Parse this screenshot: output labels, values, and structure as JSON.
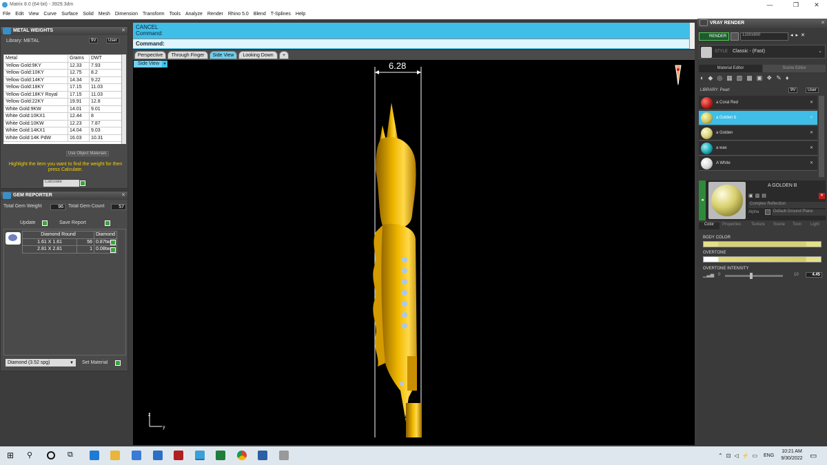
{
  "window": {
    "title": "Matrix 8.0 (64-bit) - 3929.3dm",
    "min": "—",
    "max": "❐",
    "close": "✕"
  },
  "menu": [
    "File",
    "Edit",
    "View",
    "Curve",
    "Surface",
    "Solid",
    "Mesh",
    "Dimension",
    "Transform",
    "Tools",
    "Analyze",
    "Render",
    "Rhino 5.0",
    "Blend",
    "T-Splines",
    "Help"
  ],
  "metal_weights": {
    "title": "METAL WEIGHTS",
    "library_label": "Library: METAL",
    "lib_btns": [
      "9V",
      "User"
    ],
    "columns": [
      "Metal",
      "Grams",
      "DWT"
    ],
    "rows": [
      [
        "Yellow Gold:9KY",
        "12.33",
        "7.93"
      ],
      [
        "Yellow Gold:10KY",
        "12.75",
        "8.2"
      ],
      [
        "Yellow Gold:14KY",
        "14.34",
        "9.22"
      ],
      [
        "Yellow Gold:18KY",
        "17.15",
        "11.03"
      ],
      [
        "Yellow Gold:18KY Royal",
        "17.15",
        "11.03"
      ],
      [
        "Yellow Gold:22KY",
        "19.91",
        "12.8"
      ],
      [
        "White Gold:9KW",
        "14.01",
        "9.01"
      ],
      [
        "White Gold:10KX1",
        "12.44",
        "8"
      ],
      [
        "White Gold:10KW",
        "12.23",
        "7.87"
      ],
      [
        "White Gold:14KX1",
        "14.04",
        "9.03"
      ],
      [
        "White Gold:14K PdW",
        "16.03",
        "10.31"
      ]
    ],
    "use_object": "Use Object Materials",
    "instruction": "Highlight the item you want to find the weight for then press Calculate.",
    "calculate": "Calculate"
  },
  "gem_reporter": {
    "title": "GEM REPORTER",
    "total_weight_label": "Total Gem Weight",
    "total_weight": "96",
    "total_count_label": "Total Gem Count",
    "total_count": "57",
    "update": "Update",
    "save_report": "Save Report",
    "columns": [
      "Diamond Round",
      "Diamond"
    ],
    "rows": [
      [
        "1.61 X 1.61",
        "56",
        "0.87tw"
      ],
      [
        "2.81 X 2.81",
        "1",
        "0.08tw"
      ]
    ],
    "material_select": "Diamond    (3.52 spg)",
    "set_material": "Set Material"
  },
  "command": {
    "line1": "CANCEL",
    "line2": "Command:",
    "prompt": "Command:"
  },
  "view_tabs": [
    "Perspective",
    "Through Finger",
    "Side View",
    "Looking Down"
  ],
  "active_view": "Side View",
  "viewport": {
    "dimension": "6.28",
    "axis_z": "z",
    "axis_y": "y"
  },
  "vray": {
    "title": "VRAY RENDER",
    "render": "RENDER",
    "resolution": "1200x900",
    "style_label": "STYLE",
    "style": "Classic - (Fast)",
    "tabs": [
      "Material Editor",
      "Scene Editor"
    ],
    "library": "LIBRARY: Pearl",
    "lib_btns": [
      "9V",
      "User"
    ],
    "materials": [
      {
        "name": "a Coral Red",
        "color": "#c0201c"
      },
      {
        "name": "a Golden b",
        "color": "#c9c25a"
      },
      {
        "name": "a Golden",
        "color": "#d6cf78"
      },
      {
        "name": "a wax",
        "color": "#19a6b0"
      },
      {
        "name": "A White",
        "color": "#e8e8e8"
      }
    ],
    "selected_name": "A GOLDEN B",
    "reflection": "Complex Reflection",
    "alpha": "Alpha",
    "ground": "Default Ground Plane",
    "prop_tabs": [
      "Color",
      "Properties",
      "Texture",
      "Scene",
      "Toon",
      "Light"
    ],
    "body_color": "BODY COLOR",
    "overtone": "OVERTONE",
    "overtone_intensity": "OVERTONE INTENSITY",
    "intensity_min": "0",
    "intensity_max": "10",
    "intensity_value": "4.45",
    "body_color_hex": "#e6e08a",
    "accent": "#3fbfe8"
  },
  "taskbar": {
    "lang": "ENG",
    "time": "10:21 AM",
    "date": "9/30/2022"
  }
}
